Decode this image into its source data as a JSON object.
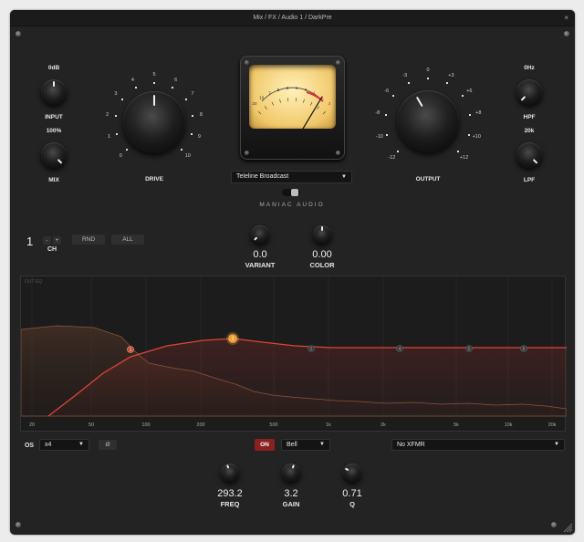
{
  "window": {
    "title": "Mix / FX / Audio 1 / DarkPre",
    "close_icon": "×"
  },
  "input_knob": {
    "value": "0dB",
    "label": "INPUT"
  },
  "mix_knob": {
    "value": "100%",
    "label": "MIX"
  },
  "drive_knob": {
    "label": "DRIVE",
    "ticks": [
      "0",
      "1",
      "2",
      "3",
      "4",
      "5",
      "6",
      "7",
      "8",
      "9",
      "10"
    ]
  },
  "vu_meter": {
    "scale": [
      "20",
      "10",
      "7",
      "5",
      "3",
      "1",
      "0",
      "1",
      "2",
      "3"
    ]
  },
  "output_knob": {
    "label": "OUTPUT",
    "ticks": [
      "-12",
      "-10",
      "-8",
      "-6",
      "-3",
      "0",
      "+3",
      "+6",
      "+8",
      "+10",
      "+12"
    ]
  },
  "hpf_knob": {
    "value": "0Hz",
    "label": "HPF"
  },
  "lpf_knob": {
    "value": "20k",
    "label": "LPF"
  },
  "preset": {
    "selected": "Teleline Broadcast",
    "arrow": "▼"
  },
  "brand": "MANIAC AUDIO",
  "channel": {
    "number": "1",
    "minus": "-",
    "plus": "+",
    "label": "CH"
  },
  "buttons": {
    "rnd": "RND",
    "all": "ALL"
  },
  "variant_knob": {
    "value": "0.0",
    "label": "VARIANT"
  },
  "color_knob": {
    "value": "0.00",
    "label": "COLOR"
  },
  "eq": {
    "title": "OUT EQ",
    "freq_labels": [
      "20",
      "50",
      "100",
      "200",
      "500",
      "1k",
      "2k",
      "5k",
      "10k",
      "20k"
    ],
    "nodes": [
      "1",
      "2",
      "3",
      "4",
      "5",
      "6"
    ]
  },
  "footer": {
    "os_label": "OS",
    "os_value": "x4",
    "phase": "Ø",
    "on_label": "ON",
    "filter_type": "Bell",
    "xfmr": "No XFMR",
    "arrow": "▼"
  },
  "freq_knob": {
    "value": "293.2",
    "label": "FREQ"
  },
  "gain_knob": {
    "value": "3.2",
    "label": "GAIN"
  },
  "q_knob": {
    "value": "0.71",
    "label": "Q"
  },
  "colors": {
    "accent": "#e0443a",
    "vu_face": "#f1c86a",
    "node_active": "#f0a030",
    "background": "#232323"
  }
}
